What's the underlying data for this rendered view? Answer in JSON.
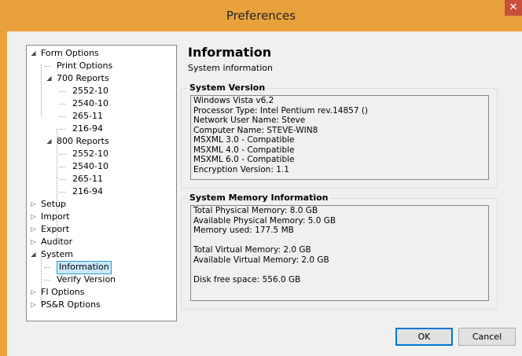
{
  "window": {
    "title": "Preferences",
    "close_glyph": "✕"
  },
  "tree": {
    "items": [
      {
        "label": "Form Options",
        "expander": "◢",
        "level": 0
      },
      {
        "label": "Print Options",
        "expander": "",
        "level": 1
      },
      {
        "label": "700 Reports",
        "expander": "◢",
        "level": 1
      },
      {
        "label": "2552-10",
        "expander": "",
        "level": 2
      },
      {
        "label": "2540-10",
        "expander": "",
        "level": 2
      },
      {
        "label": "265-11",
        "expander": "",
        "level": 2
      },
      {
        "label": "216-94",
        "expander": "",
        "level": 2
      },
      {
        "label": "800 Reports",
        "expander": "◢",
        "level": 1
      },
      {
        "label": "2552-10",
        "expander": "",
        "level": 2
      },
      {
        "label": "2540-10",
        "expander": "",
        "level": 2
      },
      {
        "label": "265-11",
        "expander": "",
        "level": 2
      },
      {
        "label": "216-94",
        "expander": "",
        "level": 2
      },
      {
        "label": "Setup",
        "expander": "▷",
        "level": 0
      },
      {
        "label": "Import",
        "expander": "▷",
        "level": 0
      },
      {
        "label": "Export",
        "expander": "▷",
        "level": 0
      },
      {
        "label": "Auditor",
        "expander": "▷",
        "level": 0
      },
      {
        "label": "System",
        "expander": "◢",
        "level": 0
      },
      {
        "label": "Information",
        "expander": "",
        "level": 1,
        "selected": true
      },
      {
        "label": "Verify Version",
        "expander": "",
        "level": 1
      },
      {
        "label": "FI Options",
        "expander": "▷",
        "level": 0
      },
      {
        "label": "PS&R Options",
        "expander": "▷",
        "level": 0
      }
    ]
  },
  "panel": {
    "heading": "Information",
    "subheading": "System information",
    "system_version": {
      "label": "System Version",
      "lines": [
        "Windows Vista  v6.2",
        "Processor Type: Intel Pentium rev.14857 ()",
        "Network User Name: Steve",
        "Computer Name: STEVE-WIN8",
        "MSXML 3.0 - Compatible",
        "MSXML 4.0 - Compatible",
        "MSXML 6.0 - Compatible",
        "Encryption Version: 1.1"
      ]
    },
    "system_memory": {
      "label": "System Memory Information",
      "lines": [
        "Total Physical Memory:   8.0 GB",
        "Available Physical Memory:   5.0 GB",
        "Memory used: 177.5 MB",
        "",
        "Total Virtual Memory:   2.0 GB",
        "Available Virtual Memory:   2.0 GB",
        "",
        "Disk free space: 556.0 GB"
      ]
    }
  },
  "buttons": {
    "ok": "OK",
    "cancel": "Cancel"
  }
}
